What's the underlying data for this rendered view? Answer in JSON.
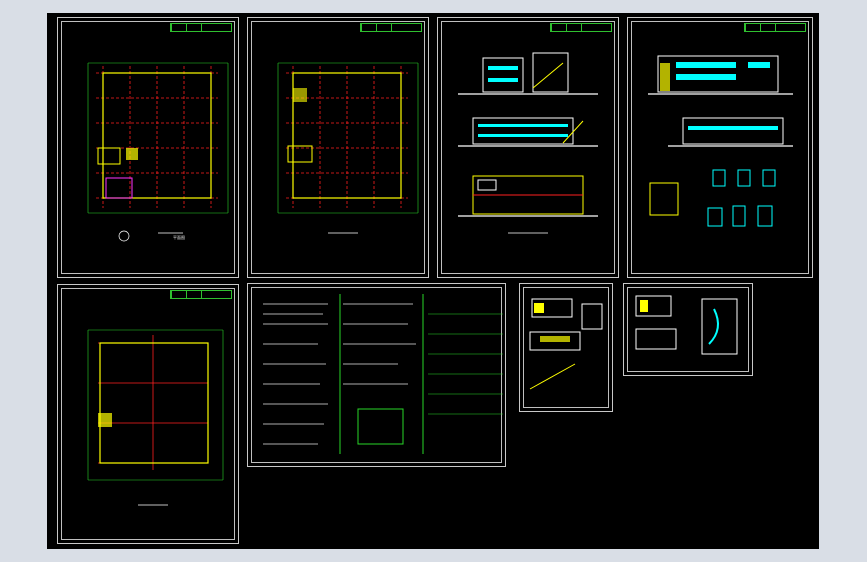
{
  "window": {
    "background": "#d9dee6",
    "model_space": "#000000"
  },
  "colors": {
    "grid_red": "#ff2020",
    "wall_yellow": "#ffff00",
    "dim_green": "#28d628",
    "cyan": "#00ffff",
    "white": "#ffffff",
    "magenta": "#ff33ff"
  },
  "sheets": [
    {
      "id": "floor-plan-1",
      "caption": "平面图"
    },
    {
      "id": "floor-plan-2",
      "caption": ""
    },
    {
      "id": "elevations-1",
      "caption": ""
    },
    {
      "id": "elevations-2",
      "caption": ""
    },
    {
      "id": "roof-plan",
      "caption": ""
    },
    {
      "id": "design-notes",
      "caption": ""
    },
    {
      "id": "stair-details",
      "caption": ""
    },
    {
      "id": "node-details",
      "caption": ""
    }
  ]
}
